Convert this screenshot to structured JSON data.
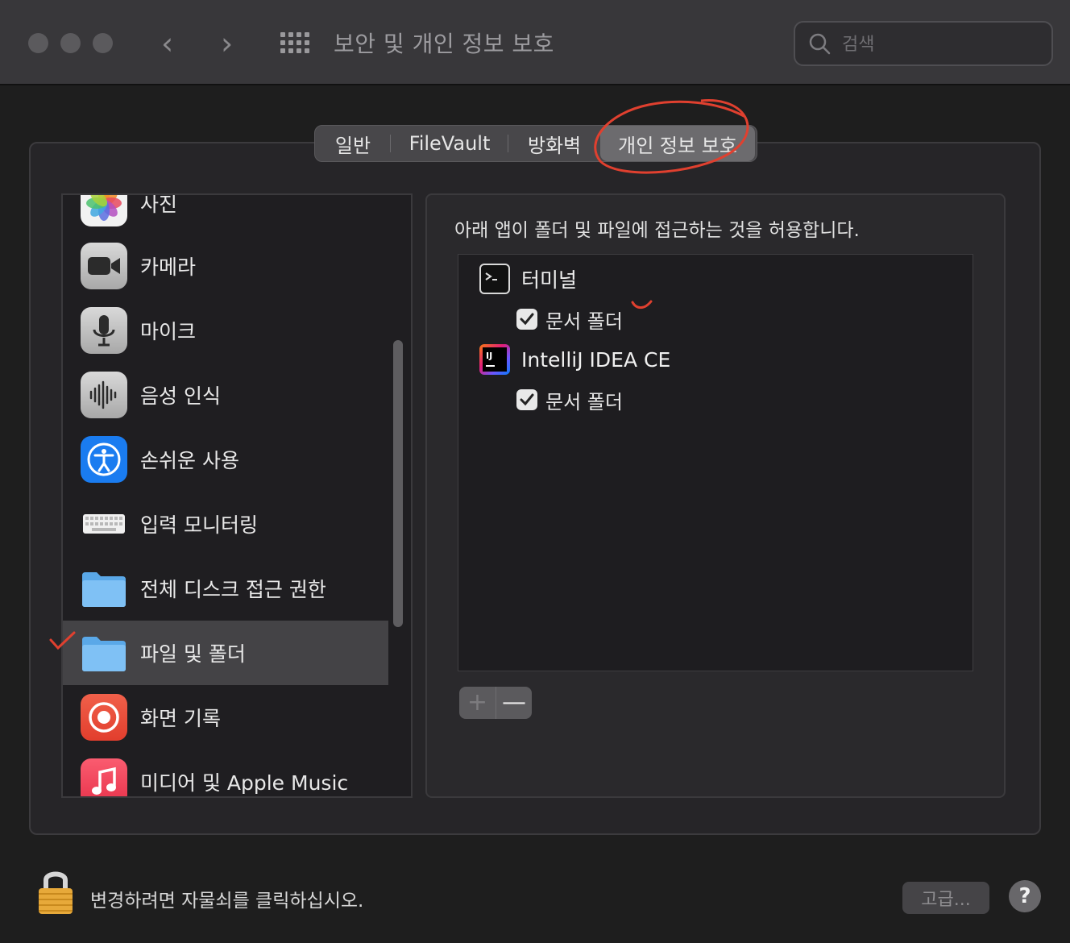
{
  "window": {
    "title": "보안 및 개인 정보 보호",
    "search_placeholder": "검색"
  },
  "tabs": [
    {
      "label": "일반",
      "active": false
    },
    {
      "label": "FileVault",
      "active": false
    },
    {
      "label": "방화벽",
      "active": false
    },
    {
      "label": "개인 정보 보호",
      "active": true
    }
  ],
  "sidebar": {
    "items": [
      {
        "label": "사진",
        "icon": "photos-icon"
      },
      {
        "label": "카메라",
        "icon": "camera-icon"
      },
      {
        "label": "마이크",
        "icon": "microphone-icon"
      },
      {
        "label": "음성 인식",
        "icon": "waveform-icon"
      },
      {
        "label": "손쉬운 사용",
        "icon": "accessibility-icon"
      },
      {
        "label": "입력 모니터링",
        "icon": "keyboard-icon"
      },
      {
        "label": "전체 디스크 접근 권한",
        "icon": "folder-icon"
      },
      {
        "label": "파일 및 폴더",
        "icon": "folder-icon",
        "selected": true
      },
      {
        "label": "화면 기록",
        "icon": "screen-record-icon"
      },
      {
        "label": "미디어 및 Apple Music",
        "icon": "music-icon"
      }
    ]
  },
  "panel": {
    "description": "아래 앱이 폴더 및 파일에 접근하는 것을 허용합니다.",
    "apps": [
      {
        "name": "터미널",
        "icon": "terminal-icon",
        "permissions": [
          {
            "label": "문서 폴더",
            "checked": true
          }
        ]
      },
      {
        "name": "IntelliJ IDEA CE",
        "icon": "intellij-icon",
        "permissions": [
          {
            "label": "문서 폴더",
            "checked": true
          }
        ]
      }
    ],
    "add_label": "+",
    "remove_label": "—"
  },
  "footer": {
    "lock_text": "변경하려면 자물쇠를 클릭하십시오.",
    "advanced_label": "고급...",
    "help_label": "?"
  },
  "colors": {
    "accent_annotation": "#e0402f",
    "selected_row": "#444346"
  }
}
